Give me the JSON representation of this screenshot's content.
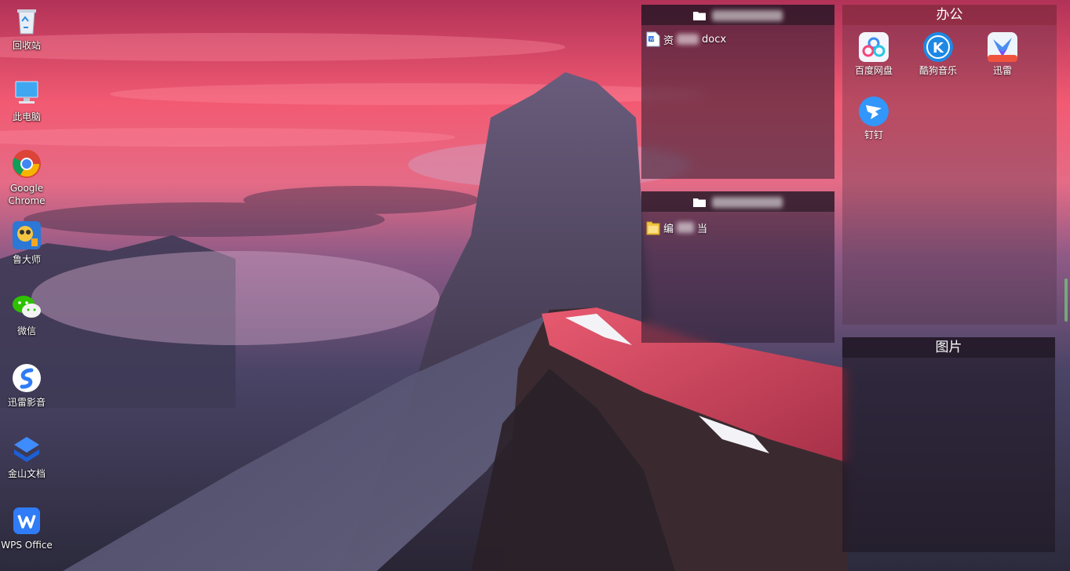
{
  "desktop": {
    "icons": [
      {
        "label": "回收站",
        "icon": "recycle-bin-icon"
      },
      {
        "label": "此电脑",
        "icon": "computer-icon"
      },
      {
        "label": "Google Chrome",
        "icon": "chrome-icon"
      },
      {
        "label": "鲁大师",
        "icon": "ludashi-icon"
      },
      {
        "label": "微信",
        "icon": "wechat-icon"
      },
      {
        "label": "迅雷影音",
        "icon": "xunlei-player-icon"
      },
      {
        "label": "金山文档",
        "icon": "kingsoft-docs-icon"
      },
      {
        "label": "WPS Office",
        "icon": "wps-office-icon"
      }
    ]
  },
  "fences": {
    "fence1": {
      "title": "",
      "files": [
        {
          "name_prefix": "资",
          "name_suffix": "docx",
          "icon": "word-document-icon"
        }
      ]
    },
    "fence2": {
      "title": "",
      "files": [
        {
          "name_prefix": "编",
          "name_suffix": "当",
          "icon": "folder-icon"
        }
      ]
    },
    "office": {
      "title": "办公",
      "apps": [
        {
          "label": "百度网盘",
          "icon": "baidu-netdisk-icon"
        },
        {
          "label": "酷狗音乐",
          "icon": "kugou-music-icon"
        },
        {
          "label": "迅雷",
          "icon": "xunlei-icon"
        },
        {
          "label": "钉钉",
          "icon": "dingtalk-icon"
        }
      ]
    },
    "pictures": {
      "title": "图片"
    }
  },
  "colors": {
    "sky_top": "#c93b5e",
    "sky_mid": "#f25a72",
    "mountain": "#3c3650",
    "ridge_red": "#d9435c"
  }
}
